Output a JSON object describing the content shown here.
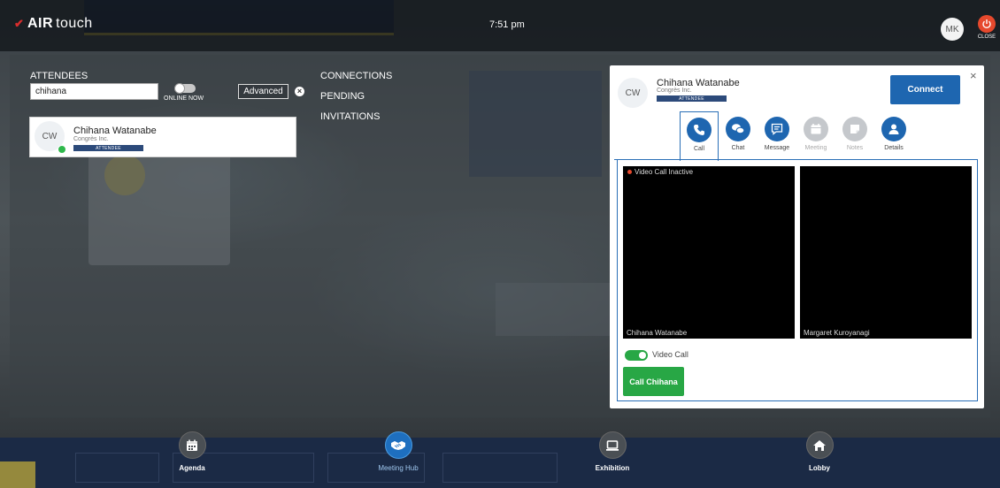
{
  "app": {
    "logo_brand": "AIR",
    "logo_suffix": "touch",
    "time": "7:51 pm",
    "user_initials": "MK",
    "close_label": "CLOSE",
    "accent": "#1e66b0",
    "success": "#28a745",
    "danger": "#e6492d"
  },
  "sidebar": {
    "attendees_label": "ATTENDEES",
    "search_value": "chihana",
    "online_now_label": "ONLINE NOW",
    "advanced_label": "Advanced",
    "links": [
      "CONNECTIONS",
      "PENDING",
      "INVITATIONS"
    ]
  },
  "results": [
    {
      "initials": "CW",
      "name": "Chihana Watanabe",
      "company": "Congrès Inc.",
      "badge": "ATTENDEE",
      "online": true
    }
  ],
  "detail": {
    "initials": "CW",
    "name": "Chihana Watanabe",
    "company": "Congrès Inc.",
    "badge": "ATTENDEE",
    "connect_label": "Connect",
    "close_glyph": "×",
    "tabs": [
      {
        "label": "Call",
        "icon": "phone-icon",
        "active": true,
        "enabled": true
      },
      {
        "label": "Chat",
        "icon": "chat-icon",
        "active": false,
        "enabled": true
      },
      {
        "label": "Message",
        "icon": "message-icon",
        "active": false,
        "enabled": true
      },
      {
        "label": "Meeting",
        "icon": "calendar-icon",
        "active": false,
        "enabled": false
      },
      {
        "label": "Notes",
        "icon": "notes-icon",
        "active": false,
        "enabled": false
      },
      {
        "label": "Details",
        "icon": "user-icon",
        "active": false,
        "enabled": true
      }
    ],
    "video_status": "Video Call Inactive",
    "video_left_name": "Chihana Watanabe",
    "video_right_name": "Margaret Kuroyanagi",
    "video_call_label": "Video Call",
    "call_button_label": "Call Chihana"
  },
  "bottom_nav": [
    {
      "label": "Agenda",
      "icon": "calendar-icon",
      "active": false
    },
    {
      "label": "Meeting Hub",
      "icon": "handshake-icon",
      "active": true
    },
    {
      "label": "Exhibition",
      "icon": "monitor-icon",
      "active": false
    },
    {
      "label": "Lobby",
      "icon": "home-icon",
      "active": false
    }
  ]
}
